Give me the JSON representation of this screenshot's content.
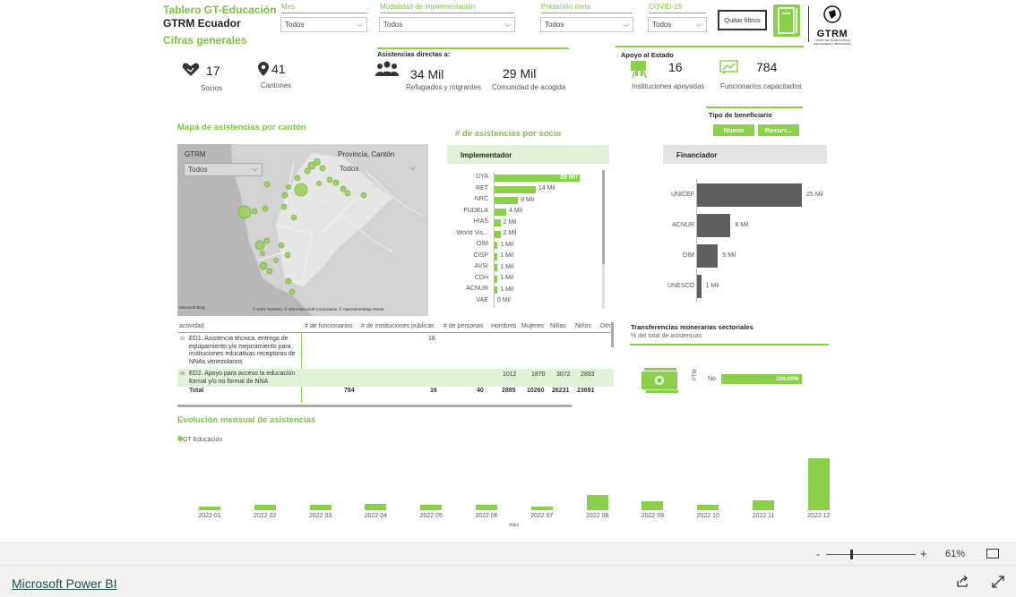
{
  "header": {
    "title": "Tablero GT-Educación",
    "org": "GTRM Ecuador",
    "subtitle": "Cifras generales"
  },
  "filters": {
    "mes": {
      "label": "Mes",
      "value": "Todos"
    },
    "modalidad": {
      "label": "Modalidad de implementación",
      "value": "Todos"
    },
    "poblacion": {
      "label": "Población meta",
      "value": "Todos"
    },
    "covid": {
      "label": "COVID-19",
      "value": "Todos"
    },
    "clear_label": "Quitar filtros"
  },
  "logo": {
    "name": "GTRM",
    "tagline": "GRUPO DE TRABAJO PARA REFUGIADOS Y MIGRANTES"
  },
  "kpis": {
    "socios": {
      "value": "17",
      "label": "Socios"
    },
    "cantones": {
      "value": "41",
      "label": "Cantones"
    },
    "asistencias_title": "Asistencias directas a:",
    "refugiados": {
      "value": "34 Mil",
      "label": "Refugiados y migrantes"
    },
    "comunidad": {
      "value": "29 Mil",
      "label": "Comunidad de acogida"
    },
    "apoyo_title": "Apoyo al Estado",
    "instituciones": {
      "value": "16",
      "label": "Instituciones apoyadas"
    },
    "funcionarios": {
      "value": "784",
      "label": "Funcionarios capacitados"
    }
  },
  "tipo_beneficiario": {
    "title": "Tipo de beneficiario",
    "options": [
      "Nuevo",
      "Recurr..."
    ]
  },
  "map": {
    "title": "Mapa de asistencias por cantón",
    "gtrm_label": "GTRM",
    "gtrm_value": "Todos",
    "provincia_label": "Provincia, Cantón",
    "provincia_value": "Todos",
    "bing": "Microsoft Bing",
    "credits": "© 2023 TomTom, © 2023 Microsoft Corporation, © OpenStreetMap  Terms"
  },
  "socios_chart": {
    "title": "# de asistencias por socio",
    "implementador_header": "Implementador",
    "financiador_header": "Financiador"
  },
  "chart_data": [
    {
      "type": "bar",
      "title": "Implementador",
      "categories": [
        "DYA",
        "RET",
        "NRC",
        "FUDELA",
        "HIAS",
        "World Vis...",
        "OIM",
        "CISP",
        "AVSI",
        "CDH",
        "ACNUR",
        "VAE"
      ],
      "values": [
        29,
        14,
        8,
        4,
        2,
        2,
        1,
        1,
        1,
        1,
        1,
        0
      ],
      "labels": [
        "29 Mil",
        "14 Mil",
        "8 Mil",
        "4 Mil",
        "2 Mil",
        "2 Mil",
        "1 Mil",
        "1 Mil",
        "1 Mil",
        "1 Mil",
        "1 Mil",
        "0 Mil"
      ],
      "color": "#8bd04a"
    },
    {
      "type": "bar",
      "title": "Financiador",
      "categories": [
        "UNICEF",
        "ACNUR",
        "OIM",
        "UNESCO"
      ],
      "values": [
        25,
        8,
        5,
        1
      ],
      "labels": [
        "25 Mil",
        "8 Mil",
        "5 Mil",
        "1 Mil"
      ],
      "color": "#5f5f5f"
    },
    {
      "type": "bar",
      "title": "Transferencias monerarias sectoriales",
      "subtitle": "% del total de asistencias",
      "categories": [
        "No"
      ],
      "values": [
        100
      ],
      "labels": [
        "100,00%"
      ],
      "ylabel": "PTM",
      "color": "#8bd04a"
    },
    {
      "type": "bar",
      "title": "Evolución mensual de asistencias",
      "series_label": "GT Educación",
      "xlabel": "mes",
      "categories": [
        "2022 01",
        "2022 02",
        "2022 03",
        "2022 04",
        "2022 05",
        "2022 06",
        "2022 07",
        "2022 08",
        "2022 09",
        "2022 10",
        "2022 11",
        "2022 12"
      ],
      "values": [
        3,
        4,
        4,
        5,
        4,
        4,
        3,
        12,
        7,
        4,
        8,
        42
      ],
      "color": "#8bd04a"
    }
  ],
  "table": {
    "headers": [
      "actividad",
      "# de funcionarios",
      "# de instituciones públicas",
      "# de personas",
      "Hombres",
      "Mujeres",
      "Niñas",
      "Niños",
      "Otro"
    ],
    "rows": [
      {
        "act": "ED1. Asistencia técnica, entrega de equipamiento y/o mejoramiento para instituciones educativas receptoras de NNAs venezolanos",
        "func": "",
        "inst": "16",
        "pers": "",
        "h": "",
        "m": "",
        "ninas": "",
        "ninos": ""
      },
      {
        "act": "ED2. Apoyo para acceso la educación formal y/o no formal de NNA",
        "func": "",
        "inst": "",
        "pers": "",
        "h": "1012",
        "m": "1870",
        "ninas": "3072",
        "ninos": "2893"
      }
    ],
    "total": {
      "act": "Total",
      "func": "784",
      "inst": "16",
      "pers": "40",
      "h": "2885",
      "m": "10260",
      "ninas": "26231",
      "ninos": "23691"
    }
  },
  "footer": {
    "zoom": "61%",
    "brand": "Microsoft Power BI",
    "zoom_minus": "-",
    "zoom_plus": "+"
  }
}
